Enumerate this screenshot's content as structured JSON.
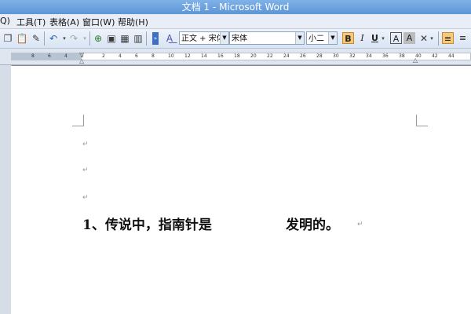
{
  "window": {
    "title": "文档 1 - Microsoft Word"
  },
  "menu": {
    "items": [
      "工具(T)",
      "表格(A)",
      "窗口(W)",
      "帮助(H)"
    ],
    "left_fragment": "Q)"
  },
  "toolbar": {
    "style_value": "正文 + 宋体",
    "font_value": "宋体",
    "size_value": "小二",
    "bold_label": "B",
    "italic_label": "I",
    "underline_label": "U",
    "char_border_label": "A",
    "char_shading_label": "A"
  },
  "ruler": {
    "ticks": [
      "8",
      "6",
      "4",
      "2",
      "2",
      "4",
      "6",
      "8",
      "10",
      "12",
      "14",
      "16",
      "18",
      "20",
      "22",
      "24",
      "26",
      "28",
      "30",
      "32",
      "34",
      "36",
      "38",
      "40",
      "42",
      "44"
    ]
  },
  "document": {
    "paragraph_mark": "↵",
    "line_text_before": "1、传说中，指南针是",
    "line_text_after": "发明的。"
  },
  "colors": {
    "title_bar": "#5d95d6",
    "bold_active": "#f7c878"
  }
}
